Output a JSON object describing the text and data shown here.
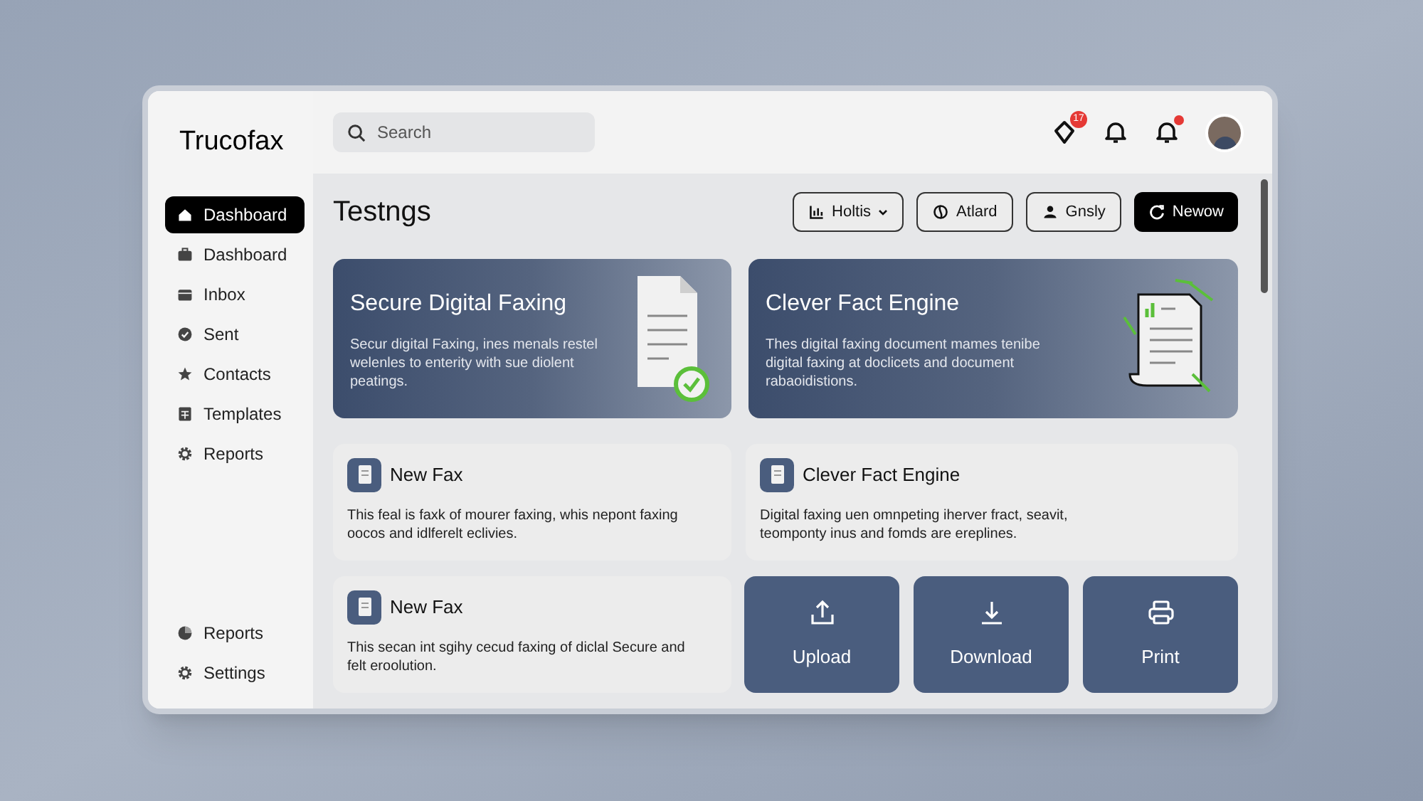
{
  "app": {
    "logo": "Trucofax"
  },
  "search": {
    "placeholder": "Search"
  },
  "header_icons": [
    {
      "kind": "alert",
      "badge": "17",
      "dot": false
    },
    {
      "kind": "bell",
      "dot": false
    },
    {
      "kind": "bell",
      "dot": true
    }
  ],
  "sidebar": {
    "items": [
      {
        "label": "Dashboard",
        "kind": "home",
        "selected": true
      },
      {
        "label": "Dashboard",
        "kind": "case",
        "selected": false
      },
      {
        "label": "Inbox",
        "kind": "tray",
        "selected": false
      },
      {
        "label": "Sent",
        "kind": "check",
        "selected": false
      },
      {
        "label": "Contacts",
        "kind": "star",
        "selected": false
      },
      {
        "label": "Templates",
        "kind": "sheet",
        "selected": false
      },
      {
        "label": "Reports",
        "kind": "gear",
        "selected": false
      }
    ],
    "bottom_items": [
      {
        "label": "Reports",
        "kind": "pie",
        "selected": false
      },
      {
        "label": "Settings",
        "kind": "gear",
        "selected": false
      }
    ]
  },
  "page": {
    "title": "Testngs",
    "actions": [
      {
        "label": "Holtis",
        "kind": "chart",
        "dropdown": true,
        "primary": false
      },
      {
        "label": "Atlard",
        "kind": "swirl",
        "dropdown": false,
        "primary": false
      },
      {
        "label": "Gnsly",
        "kind": "user",
        "dropdown": false,
        "primary": false
      },
      {
        "label": "Newow",
        "kind": "refresh",
        "dropdown": false,
        "primary": true
      }
    ]
  },
  "hero_cards": [
    {
      "title": "Secure Digital Faxing",
      "text": "Secur digital Faxing, ines menals restel welenles to enterity with sue diolent peatings.",
      "kind": "doc-check"
    },
    {
      "title": "Clever Fact Engine",
      "text": "Thes digital faxing document mames tenibe digital faxing at doclicets and document rabaoidistions.",
      "kind": "doc-arrows"
    }
  ],
  "info_cards": [
    {
      "title": "New Fax",
      "text": "This feal is faxk of mourer faxing, whis nepont faxing oocos and idlferelt eclivies."
    },
    {
      "title": "Clever Fact Engine",
      "text": "Digital faxing uen omnpeting iherver fract, seavit, teomponty inus and fomds are ereplines."
    },
    {
      "title": "New Fax",
      "text": "This secan int sgihy cecud faxing of diclal Secure and felt eroolution."
    }
  ],
  "tiles": [
    {
      "label": "Upload",
      "kind": "upload"
    },
    {
      "label": "Download",
      "kind": "download"
    },
    {
      "label": "Print",
      "kind": "print"
    }
  ]
}
